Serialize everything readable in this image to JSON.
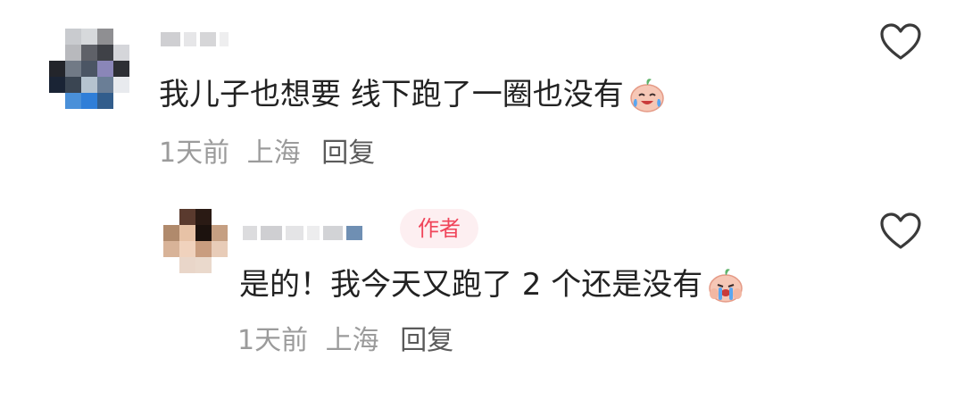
{
  "comments": [
    {
      "text": "我儿子也想要 线下跑了一圈也没有",
      "emoji": "crying-laugh-peach-emoji",
      "meta": {
        "time": "1天前",
        "location": "上海",
        "reply": "回复"
      },
      "is_author": false
    },
    {
      "text": "是的！我今天又跑了 2 个还是没有",
      "emoji": "crying-peach-emoji",
      "badge": "作者",
      "meta": {
        "time": "1天前",
        "location": "上海",
        "reply": "回复"
      },
      "is_author": true
    }
  ],
  "colors": {
    "author_badge_bg": "#fdeff1",
    "author_badge_text": "#f0455a",
    "meta_text": "#9b9b9b",
    "reply_text": "#5a5a5a",
    "body_text": "#222222"
  },
  "icons": [
    "heart-outline-icon"
  ]
}
